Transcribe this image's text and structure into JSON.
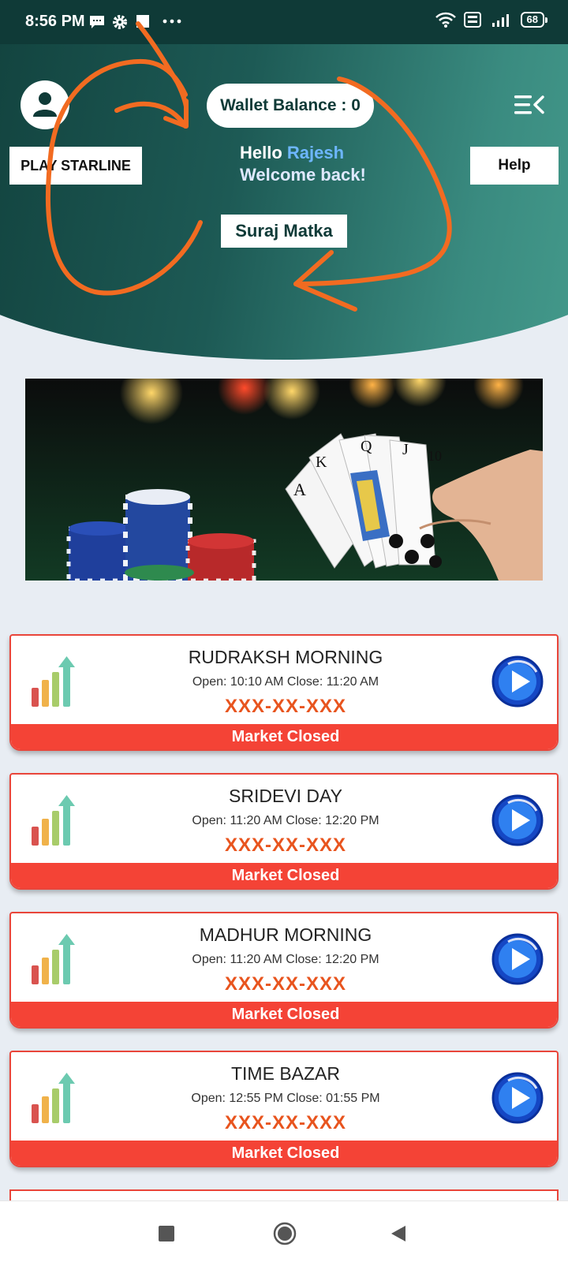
{
  "status_bar": {
    "time": "8:56 PM",
    "battery": "68",
    "left_icons": [
      "message-icon",
      "settings-icon",
      "square-icon",
      "more-dots-icon"
    ],
    "right_icons": [
      "wifi-icon",
      "volte-icon",
      "signal-icon",
      "battery-icon"
    ]
  },
  "header": {
    "wallet_label": "Wallet Balance : 0",
    "starline_button": "PLAY STARLINE",
    "help_button": "Help",
    "greeting_hello": "Hello",
    "greeting_name": "Rajesh",
    "greeting_welcome": "Welcome back!",
    "brand": "Suraj Matka",
    "icons": [
      "user-icon",
      "menu-icon"
    ]
  },
  "markets": [
    {
      "name": "RUDRAKSH MORNING",
      "times": "Open: 10:10 AM  Close: 11:20 AM",
      "result": "XXX-XX-XXX",
      "status": "Market Closed"
    },
    {
      "name": "SRIDEVI DAY",
      "times": "Open: 11:20 AM  Close: 12:20 PM",
      "result": "XXX-XX-XXX",
      "status": "Market Closed"
    },
    {
      "name": "MADHUR MORNING",
      "times": "Open: 11:20 AM  Close: 12:20 PM",
      "result": "XXX-XX-XXX",
      "status": "Market Closed"
    },
    {
      "name": "TIME BAZAR",
      "times": "Open: 12:55 PM  Close: 01:55 PM",
      "result": "XXX-XX-XXX",
      "status": "Market Closed"
    }
  ],
  "colors": {
    "header_dark": "#0e3a36",
    "header_light": "#4aa392",
    "card_border": "#e9453a",
    "status_red": "#f44336",
    "result_orange": "#e8541e",
    "annotation_orange": "#f26b21"
  },
  "nav_bar": {
    "icons": [
      "recent-apps-icon",
      "home-icon",
      "back-icon"
    ]
  }
}
